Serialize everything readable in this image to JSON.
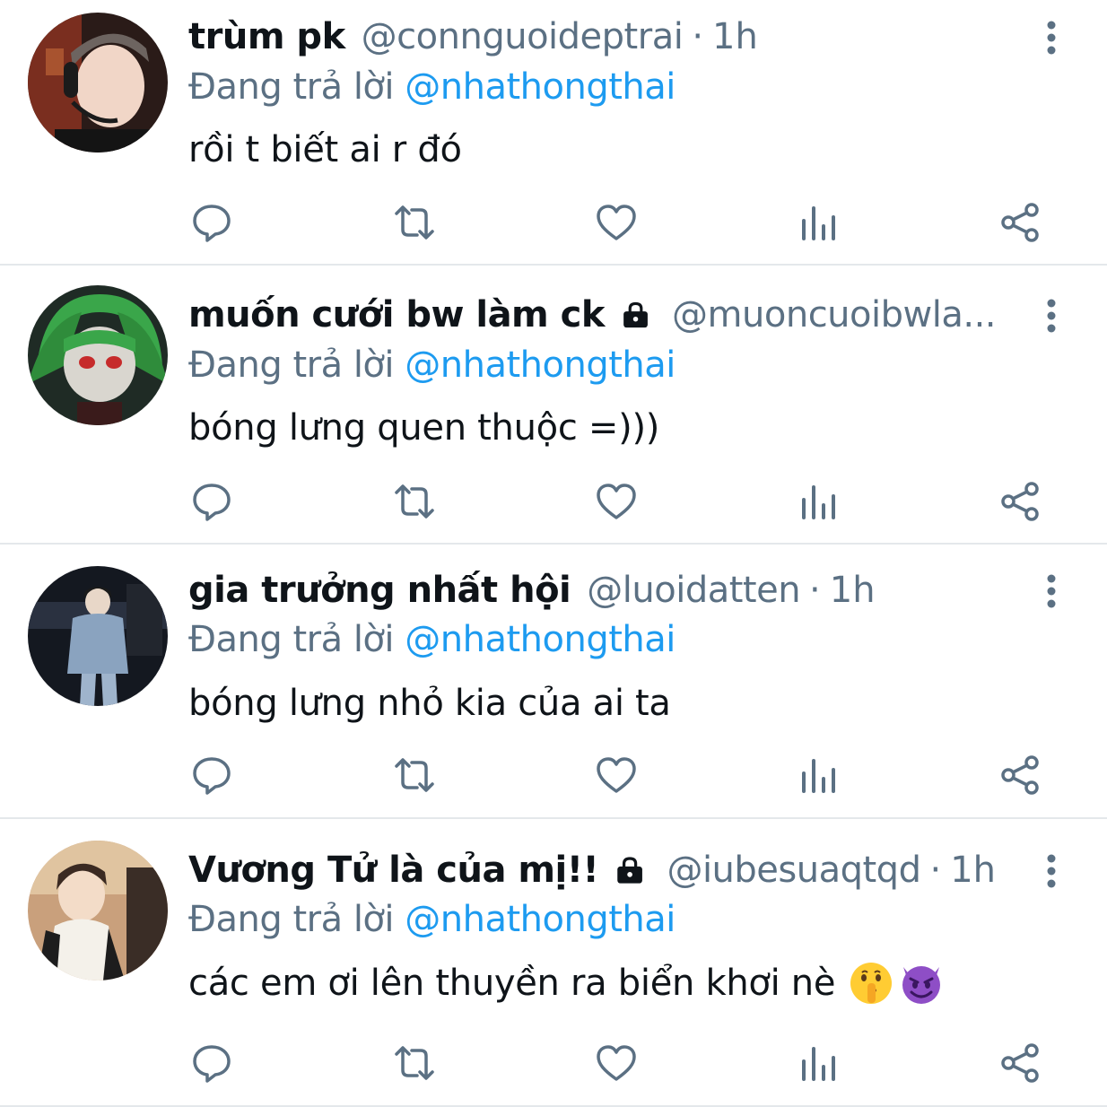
{
  "colors": {
    "text": "#0f1419",
    "secondary": "#5b7083",
    "accent": "#1d9bf0",
    "divider": "#e4e8eb"
  },
  "tweets": [
    {
      "name": "trùm pk",
      "locked": false,
      "handle": "@connguoideptrai",
      "separator": "·",
      "time": "1h",
      "replying_prefix": "Đang trả lời",
      "replying_to": "@nhathongthai",
      "text": "rồi t biết ai r đó",
      "emojis": []
    },
    {
      "name": "muốn cưới bw làm ck",
      "locked": true,
      "handle": "@muoncuoibwla...",
      "separator": "",
      "time": "",
      "replying_prefix": "Đang trả lời",
      "replying_to": "@nhathongthai",
      "text": "bóng lưng quen thuộc =)))",
      "emojis": []
    },
    {
      "name": "gia trưởng nhất hội",
      "locked": false,
      "handle": "@luoidatten",
      "separator": "·",
      "time": "1h",
      "replying_prefix": "Đang trả lời",
      "replying_to": "@nhathongthai",
      "text": "bóng lưng nhỏ kia của ai ta",
      "emojis": []
    },
    {
      "name": "Vương Tử là của mị!!",
      "locked": true,
      "handle": "@iubesuaqtqd",
      "separator": "·",
      "time": "1h",
      "replying_prefix": "Đang trả lời",
      "replying_to": "@nhathongthai",
      "text": "các em ơi lên thuyền ra biển khơi nè",
      "emojis": [
        "shushing-face-emoji",
        "smiling-imp-emoji"
      ]
    }
  ],
  "action_icons": [
    "reply-icon",
    "retweet-icon",
    "like-icon",
    "analytics-icon",
    "share-icon"
  ]
}
